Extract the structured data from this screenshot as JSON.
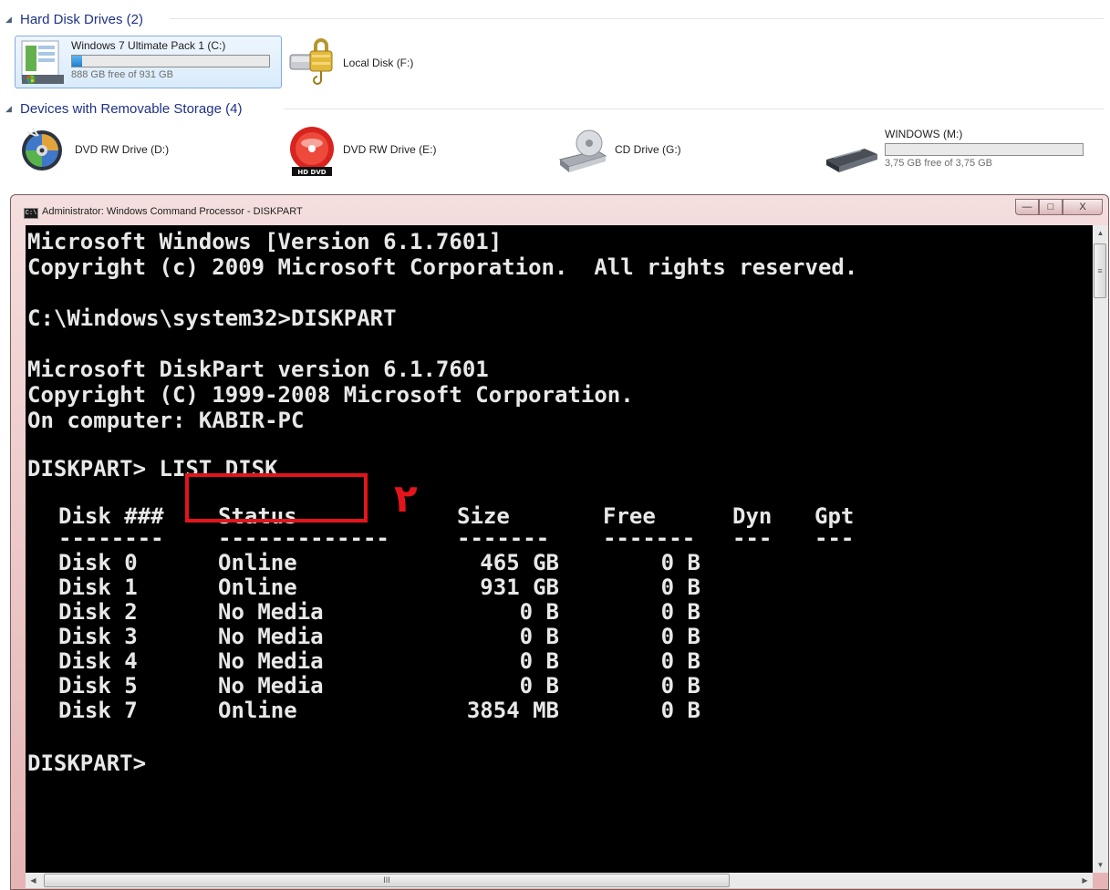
{
  "explorer": {
    "group_hdd": {
      "title": "Hard Disk Drives (2)"
    },
    "drive_c": {
      "name": "Windows 7 Ultimate Pack 1 (C:)",
      "free_text": "888 GB free of 931 GB",
      "used_fraction": 0.05
    },
    "drive_f": {
      "name": "Local Disk (F:)"
    },
    "group_removable": {
      "title": "Devices with Removable Storage (4)"
    },
    "drive_d": {
      "name": "DVD RW Drive (D:)"
    },
    "drive_e": {
      "name": "DVD RW Drive (E:)",
      "badge": "HD DVD"
    },
    "drive_g": {
      "name": "CD Drive (G:)"
    },
    "drive_m": {
      "name": "WINDOWS (M:)",
      "free_text": "3,75 GB free of 3,75 GB",
      "used_fraction": 0.0
    }
  },
  "window": {
    "title": "Administrator: Windows Command Processor - DISKPART",
    "icon_text": "C:\\",
    "minimize": "—",
    "maximize": "□",
    "close": "X"
  },
  "console": {
    "line1": "Microsoft Windows [Version 6.1.7601]",
    "line2": "Copyright (c) 2009 Microsoft Corporation.  All rights reserved.",
    "line3": "C:\\Windows\\system32>DISKPART",
    "line4": "Microsoft DiskPart version 6.1.7601",
    "line5": "Copyright (C) 1999-2008 Microsoft Corporation.",
    "line6": "On computer: KABIR-PC",
    "prompt1": "DISKPART> LIST DISK",
    "table": {
      "headers": [
        "Disk ###",
        "Status",
        "Size",
        "Free",
        "Dyn",
        "Gpt"
      ],
      "separators": [
        "--------",
        "-------------",
        "-------",
        "-------",
        "---",
        "---"
      ],
      "rows": [
        [
          "Disk 0",
          "Online",
          "465 GB",
          "0 B"
        ],
        [
          "Disk 1",
          "Online",
          "931 GB",
          "0 B"
        ],
        [
          "Disk 2",
          "No Media",
          "0 B",
          "0 B"
        ],
        [
          "Disk 3",
          "No Media",
          "0 B",
          "0 B"
        ],
        [
          "Disk 4",
          "No Media",
          "0 B",
          "0 B"
        ],
        [
          "Disk 5",
          "No Media",
          "0 B",
          "0 B"
        ],
        [
          "Disk 7",
          "Online",
          "3854 MB",
          "0 B"
        ]
      ]
    },
    "prompt2": "DISKPART>"
  },
  "annotation": {
    "marker": "٢",
    "color": "#e3151b"
  },
  "scrollbars": {
    "h_grip": "III",
    "v_grip": "≡"
  }
}
